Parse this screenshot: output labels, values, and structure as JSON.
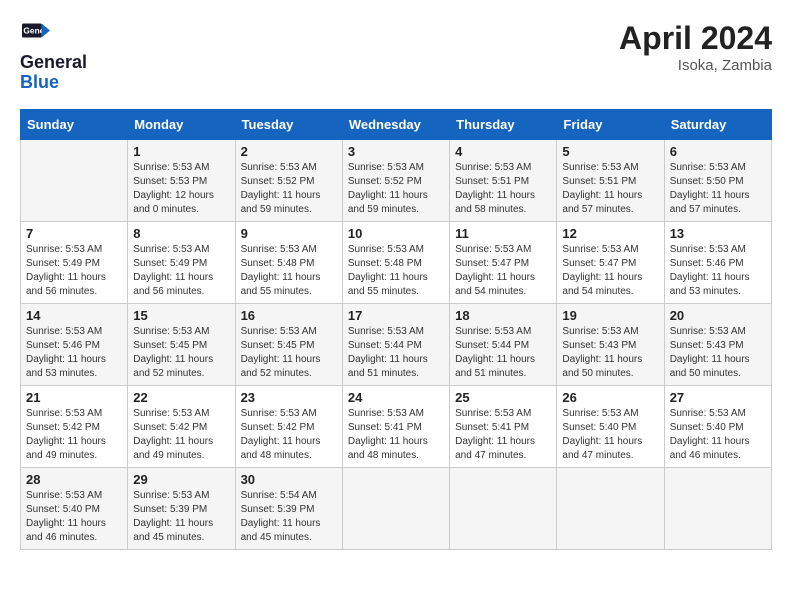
{
  "header": {
    "logo_line1": "General",
    "logo_line2": "Blue",
    "month_year": "April 2024",
    "location": "Isoka, Zambia"
  },
  "weekdays": [
    "Sunday",
    "Monday",
    "Tuesday",
    "Wednesday",
    "Thursday",
    "Friday",
    "Saturday"
  ],
  "weeks": [
    [
      {
        "day": "",
        "info": ""
      },
      {
        "day": "1",
        "info": "Sunrise: 5:53 AM\nSunset: 5:53 PM\nDaylight: 12 hours\nand 0 minutes."
      },
      {
        "day": "2",
        "info": "Sunrise: 5:53 AM\nSunset: 5:52 PM\nDaylight: 11 hours\nand 59 minutes."
      },
      {
        "day": "3",
        "info": "Sunrise: 5:53 AM\nSunset: 5:52 PM\nDaylight: 11 hours\nand 59 minutes."
      },
      {
        "day": "4",
        "info": "Sunrise: 5:53 AM\nSunset: 5:51 PM\nDaylight: 11 hours\nand 58 minutes."
      },
      {
        "day": "5",
        "info": "Sunrise: 5:53 AM\nSunset: 5:51 PM\nDaylight: 11 hours\nand 57 minutes."
      },
      {
        "day": "6",
        "info": "Sunrise: 5:53 AM\nSunset: 5:50 PM\nDaylight: 11 hours\nand 57 minutes."
      }
    ],
    [
      {
        "day": "7",
        "info": "Sunrise: 5:53 AM\nSunset: 5:49 PM\nDaylight: 11 hours\nand 56 minutes."
      },
      {
        "day": "8",
        "info": "Sunrise: 5:53 AM\nSunset: 5:49 PM\nDaylight: 11 hours\nand 56 minutes."
      },
      {
        "day": "9",
        "info": "Sunrise: 5:53 AM\nSunset: 5:48 PM\nDaylight: 11 hours\nand 55 minutes."
      },
      {
        "day": "10",
        "info": "Sunrise: 5:53 AM\nSunset: 5:48 PM\nDaylight: 11 hours\nand 55 minutes."
      },
      {
        "day": "11",
        "info": "Sunrise: 5:53 AM\nSunset: 5:47 PM\nDaylight: 11 hours\nand 54 minutes."
      },
      {
        "day": "12",
        "info": "Sunrise: 5:53 AM\nSunset: 5:47 PM\nDaylight: 11 hours\nand 54 minutes."
      },
      {
        "day": "13",
        "info": "Sunrise: 5:53 AM\nSunset: 5:46 PM\nDaylight: 11 hours\nand 53 minutes."
      }
    ],
    [
      {
        "day": "14",
        "info": "Sunrise: 5:53 AM\nSunset: 5:46 PM\nDaylight: 11 hours\nand 53 minutes."
      },
      {
        "day": "15",
        "info": "Sunrise: 5:53 AM\nSunset: 5:45 PM\nDaylight: 11 hours\nand 52 minutes."
      },
      {
        "day": "16",
        "info": "Sunrise: 5:53 AM\nSunset: 5:45 PM\nDaylight: 11 hours\nand 52 minutes."
      },
      {
        "day": "17",
        "info": "Sunrise: 5:53 AM\nSunset: 5:44 PM\nDaylight: 11 hours\nand 51 minutes."
      },
      {
        "day": "18",
        "info": "Sunrise: 5:53 AM\nSunset: 5:44 PM\nDaylight: 11 hours\nand 51 minutes."
      },
      {
        "day": "19",
        "info": "Sunrise: 5:53 AM\nSunset: 5:43 PM\nDaylight: 11 hours\nand 50 minutes."
      },
      {
        "day": "20",
        "info": "Sunrise: 5:53 AM\nSunset: 5:43 PM\nDaylight: 11 hours\nand 50 minutes."
      }
    ],
    [
      {
        "day": "21",
        "info": "Sunrise: 5:53 AM\nSunset: 5:42 PM\nDaylight: 11 hours\nand 49 minutes."
      },
      {
        "day": "22",
        "info": "Sunrise: 5:53 AM\nSunset: 5:42 PM\nDaylight: 11 hours\nand 49 minutes."
      },
      {
        "day": "23",
        "info": "Sunrise: 5:53 AM\nSunset: 5:42 PM\nDaylight: 11 hours\nand 48 minutes."
      },
      {
        "day": "24",
        "info": "Sunrise: 5:53 AM\nSunset: 5:41 PM\nDaylight: 11 hours\nand 48 minutes."
      },
      {
        "day": "25",
        "info": "Sunrise: 5:53 AM\nSunset: 5:41 PM\nDaylight: 11 hours\nand 47 minutes."
      },
      {
        "day": "26",
        "info": "Sunrise: 5:53 AM\nSunset: 5:40 PM\nDaylight: 11 hours\nand 47 minutes."
      },
      {
        "day": "27",
        "info": "Sunrise: 5:53 AM\nSunset: 5:40 PM\nDaylight: 11 hours\nand 46 minutes."
      }
    ],
    [
      {
        "day": "28",
        "info": "Sunrise: 5:53 AM\nSunset: 5:40 PM\nDaylight: 11 hours\nand 46 minutes."
      },
      {
        "day": "29",
        "info": "Sunrise: 5:53 AM\nSunset: 5:39 PM\nDaylight: 11 hours\nand 45 minutes."
      },
      {
        "day": "30",
        "info": "Sunrise: 5:54 AM\nSunset: 5:39 PM\nDaylight: 11 hours\nand 45 minutes."
      },
      {
        "day": "",
        "info": ""
      },
      {
        "day": "",
        "info": ""
      },
      {
        "day": "",
        "info": ""
      },
      {
        "day": "",
        "info": ""
      }
    ]
  ]
}
